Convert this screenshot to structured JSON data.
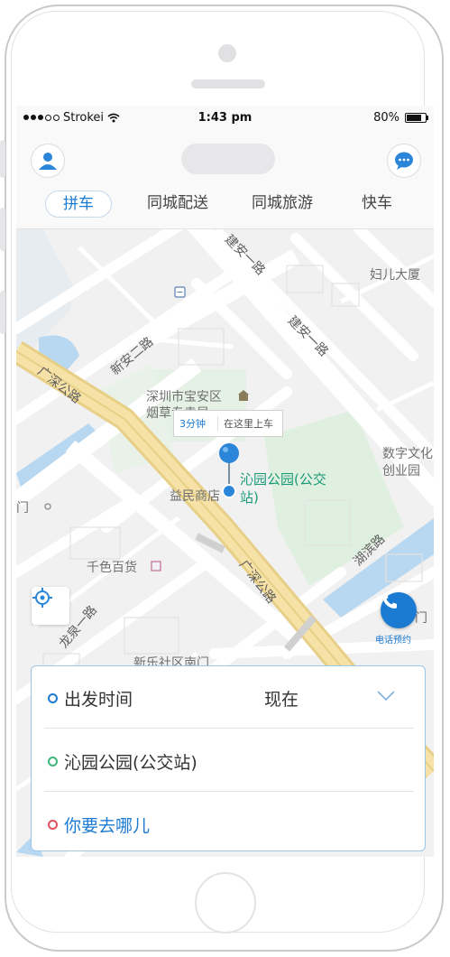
{
  "status_bar": {
    "carrier": "Strokei",
    "time": "1:43 pm",
    "battery": "80%"
  },
  "nav": {
    "tabs": [
      {
        "label": "拼车",
        "active": true
      },
      {
        "label": "同城配送",
        "active": false
      },
      {
        "label": "同城旅游",
        "active": false
      },
      {
        "label": "快车",
        "active": false
      }
    ]
  },
  "map": {
    "roads": [
      "建安一路",
      "建安一路",
      "新安二路",
      "广深公路",
      "广深公路",
      "湖滨路",
      "龙泉一路"
    ],
    "places": [
      "妇儿大厦",
      "深圳市宝安区",
      "烟草专卖局",
      "数字文化",
      "创业园",
      "益民商店",
      "千色百货",
      "新乐社区南门",
      "门",
      "门"
    ],
    "pickup": {
      "eta": "3分钟",
      "hint": "在这里上车",
      "name_line1": "沁园公园(公交",
      "name_line2": "站)"
    },
    "call_label": "电话预约"
  },
  "panel": {
    "depart_label": "出发时间",
    "depart_value": "现在",
    "origin": "沁园公园(公交站)",
    "destination_placeholder": "你要去哪儿"
  },
  "colors": {
    "accent": "#1b7ad2",
    "origin_ring": "#3db57a",
    "dest_ring": "#e0505f"
  }
}
